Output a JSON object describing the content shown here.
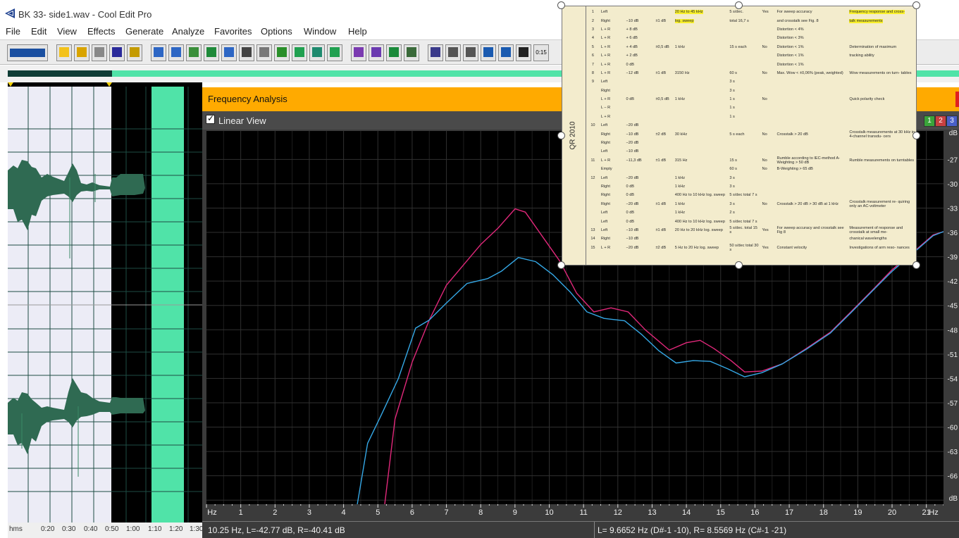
{
  "window": {
    "title": "BK 33- side1.wav - Cool Edit Pro"
  },
  "menu": [
    "File",
    "Edit",
    "View",
    "Effects",
    "Generate",
    "Analyze",
    "Favorites",
    "Options",
    "Window",
    "Help"
  ],
  "toolbar": {
    "buttons": [
      "toggle-wave-icon",
      "new-icon",
      "open-icon",
      "close-icon",
      "save-icon",
      "save-all-icon",
      "undo-icon",
      "redo-icon",
      "repeat-icon",
      "zoom-full-icon",
      "copy-icon",
      "cut-icon",
      "paste-icon",
      "paste-new-icon",
      "mix-paste-icon",
      "crop-icon",
      "trim-icon",
      "spectral-icon",
      "settings-icon",
      "grid-icon",
      "multitrack-icon",
      "view-icon",
      "cd-icon",
      "cursor-icon",
      "play-icon",
      "zoom-icon",
      "time-icon"
    ],
    "time_label": "0:15"
  },
  "waveform": {
    "ruler_unit": "hms",
    "ruler_ticks": [
      "0:20",
      "0:30",
      "0:40",
      "0:50",
      "1:00",
      "1:10",
      "1:20",
      "1:30"
    ]
  },
  "frequency_analysis": {
    "title": "Frequency Analysis",
    "linear_view_label": "Linear View",
    "linear_view_checked": true,
    "channel_buttons": [
      "1",
      "2",
      "3"
    ],
    "status_left": "10.25 Hz, L=-42.77 dB, R=-40.41 dB",
    "status_right": "L= 9.6652 Hz (D#-1 -10), R= 8.5569 Hz (C#-1 -21)",
    "colors": {
      "left": "#e0287a",
      "right": "#35a8e6",
      "grid": "#2e2e2e",
      "background": "#000000",
      "header": "#ffaa00"
    }
  },
  "chart_data": {
    "type": "line",
    "title": "",
    "xlabel": "Hz",
    "ylabel": "dB",
    "xlim": [
      0,
      21.5
    ],
    "ylim": [
      -69.5,
      -23.5
    ],
    "x_ticks": [
      "Hz",
      "1",
      "2",
      "3",
      "4",
      "5",
      "6",
      "7",
      "8",
      "9",
      "10",
      "11",
      "12",
      "13",
      "14",
      "15",
      "16",
      "17",
      "18",
      "19",
      "20",
      "21",
      "Hz"
    ],
    "y_ticks": [
      "dB",
      "-27",
      "-30",
      "-33",
      "-36",
      "-39",
      "-42",
      "-45",
      "-48",
      "-51",
      "-54",
      "-57",
      "-60",
      "-63",
      "-66",
      "dB"
    ],
    "grid": true,
    "series": [
      {
        "color": "#e0287a",
        "points": [
          [
            5.2,
            -69.5
          ],
          [
            5.5,
            -59
          ],
          [
            6.0,
            -52
          ],
          [
            6.5,
            -46.8
          ],
          [
            7.0,
            -42.5
          ],
          [
            7.5,
            -40
          ],
          [
            8.0,
            -37.5
          ],
          [
            8.5,
            -35.5
          ],
          [
            9.0,
            -33.1
          ],
          [
            9.3,
            -33.5
          ],
          [
            9.8,
            -36.5
          ],
          [
            10.3,
            -39.5
          ],
          [
            10.8,
            -43.5
          ],
          [
            11.3,
            -45.8
          ],
          [
            11.8,
            -45.3
          ],
          [
            12.3,
            -45.8
          ],
          [
            12.8,
            -48
          ],
          [
            13.5,
            -50.5
          ],
          [
            14.0,
            -49.6
          ],
          [
            14.4,
            -49.3
          ],
          [
            14.8,
            -50.3
          ],
          [
            15.3,
            -51.8
          ],
          [
            15.7,
            -53.2
          ],
          [
            16.2,
            -53.1
          ],
          [
            16.8,
            -52.2
          ],
          [
            17.5,
            -50.3
          ],
          [
            18.2,
            -48.3
          ],
          [
            18.8,
            -45.8
          ],
          [
            19.5,
            -42.8
          ],
          [
            20.0,
            -40.6
          ],
          [
            20.6,
            -38.5
          ],
          [
            21.2,
            -36.3
          ],
          [
            21.5,
            -35.9
          ]
        ]
      },
      {
        "color": "#35a8e6",
        "points": [
          [
            4.4,
            -69.5
          ],
          [
            4.7,
            -62
          ],
          [
            5.1,
            -58.5
          ],
          [
            5.6,
            -54
          ],
          [
            6.1,
            -47.8
          ],
          [
            6.5,
            -46.8
          ],
          [
            7.0,
            -44.7
          ],
          [
            7.6,
            -42.3
          ],
          [
            8.2,
            -41.7
          ],
          [
            8.6,
            -40.8
          ],
          [
            9.1,
            -39.1
          ],
          [
            9.6,
            -39.6
          ],
          [
            10.1,
            -41.2
          ],
          [
            10.6,
            -43.3
          ],
          [
            11.1,
            -45.8
          ],
          [
            11.6,
            -46.6
          ],
          [
            12.2,
            -46.9
          ],
          [
            12.7,
            -48.6
          ],
          [
            13.2,
            -50.6
          ],
          [
            13.7,
            -52.1
          ],
          [
            14.2,
            -51.8
          ],
          [
            14.7,
            -51.9
          ],
          [
            15.2,
            -52.8
          ],
          [
            15.7,
            -53.8
          ],
          [
            16.2,
            -53.3
          ],
          [
            16.8,
            -52.2
          ],
          [
            17.5,
            -50.4
          ],
          [
            18.2,
            -48.4
          ],
          [
            18.8,
            -45.9
          ],
          [
            19.5,
            -42.9
          ],
          [
            20.0,
            -40.8
          ],
          [
            20.6,
            -38.6
          ],
          [
            21.2,
            -36.4
          ],
          [
            21.5,
            -35.9
          ]
        ]
      }
    ]
  },
  "document_image": {
    "side_label": "QR 2010",
    "rows": [
      [
        "1",
        "Left",
        "",
        "",
        "20 Hz to 45 kHz",
        "5 s/dec.",
        "Yes",
        "For sweep accuracy",
        "Frequency response and cross-"
      ],
      [
        "2",
        "Right",
        "−10 dB",
        "±1 dB",
        "log. sweep",
        "total 16,7 s",
        "",
        "and crosstalk see Fig. 8",
        "talk measurements"
      ],
      [
        "3",
        "L + R",
        "+ 8 dB",
        "",
        "",
        "",
        "",
        "Distortion < 4%",
        ""
      ],
      [
        "4",
        "L + R",
        "+ 6 dB",
        "",
        "",
        "",
        "",
        "Distortion < 3%",
        ""
      ],
      [
        "5",
        "L + R",
        "+ 4 dB",
        "±0,5 dB",
        "1 kHz",
        "15 s each",
        "No",
        "Distortion < 1%",
        "Determination of maximum"
      ],
      [
        "6",
        "L + R",
        "+ 2 dB",
        "",
        "",
        "",
        "",
        "Distortion < 1%",
        "tracking ability"
      ],
      [
        "7",
        "L + R",
        "0 dB",
        "",
        "",
        "",
        "",
        "Distortion < 1%",
        ""
      ],
      [
        "8",
        "L + R",
        "−12 dB",
        "±1 dB",
        "3150 Hz",
        "60 s",
        "No",
        "Max. Wow < ±0,06% (peak, weighted)",
        "Wow measurements on turn- tables"
      ],
      [
        "9",
        "Left",
        "",
        "",
        "",
        "3 s",
        "",
        "",
        ""
      ],
      [
        "",
        "Right",
        "",
        "",
        "",
        "3 s",
        "",
        "",
        ""
      ],
      [
        "",
        "L + R",
        "0 dB",
        "±0,5 dB",
        "1 kHz",
        "1 s",
        "No",
        "",
        "Quick polarity check"
      ],
      [
        "",
        "L − R",
        "",
        "",
        "",
        "1 s",
        "",
        "",
        ""
      ],
      [
        "",
        "L + R",
        "",
        "",
        "",
        "1 s",
        "",
        "",
        ""
      ],
      [
        "10",
        "Left",
        "−20 dB",
        "",
        "",
        "",
        "",
        "",
        ""
      ],
      [
        "",
        "Right",
        "−10 dB",
        "±2 dB",
        "30 kHz",
        "5 s each",
        "No",
        "Crosstalk > 20 dB",
        "Crosstalk measurements at 30 kHz in 4-channel transdu- cers"
      ],
      [
        "",
        "Right",
        "−20 dB",
        "",
        "",
        "",
        "",
        "",
        ""
      ],
      [
        "",
        "Left",
        "−10 dB",
        "",
        "",
        "",
        "",
        "",
        ""
      ],
      [
        "11",
        "L + R",
        "−11,3 dB",
        "±1 dB",
        "315 Hz",
        "15 s",
        "No",
        "Rumble according to IEC-method A-Weighting > 50 dB",
        "Rumble measurements on turntables"
      ],
      [
        "",
        "Empty",
        "",
        "",
        "",
        "60 s",
        "No",
        "B-Weighting > 65 dB",
        ""
      ],
      [
        "12",
        "Left",
        "−20 dB",
        "",
        "1 kHz",
        "3 s",
        "",
        "",
        ""
      ],
      [
        "",
        "Right",
        "0 dB",
        "",
        "1 kHz",
        "3 s",
        "",
        "",
        ""
      ],
      [
        "",
        "Right",
        "0 dB",
        "",
        "400 Hz to 10 kHz log. sweep",
        "5 s/dec total 7 s",
        "",
        "",
        ""
      ],
      [
        "",
        "Right",
        "−20 dB",
        "±1 dB",
        "1 kHz",
        "3 s",
        "No",
        "Crosstalk > 20 dB > 30 dB at 1 kHz",
        "Crosstalk measurement re- quiring only an AC-voltmeter"
      ],
      [
        "",
        "Left",
        "0 dB",
        "",
        "1 kHz",
        "2 s",
        "",
        "",
        ""
      ],
      [
        "",
        "Left",
        "0 dB",
        "",
        "400 Hz to 10 kHz log. sweep",
        "5 s/dec total 7 s",
        "",
        "",
        ""
      ],
      [
        "13",
        "Left",
        "−10 dB",
        "±1 dB",
        "20 Hz to 20 kHz log. sweep",
        "5 s/dec. total 15 s",
        "Yes",
        "For sweep accuracy and crosstalk see Fig 8",
        "Measurement of response and crosstalk at small me-"
      ],
      [
        "14",
        "Right",
        "−10 dB",
        "",
        "",
        "",
        "",
        "",
        "chanical wavelengths"
      ],
      [
        "15",
        "L + R",
        "−20 dB",
        "±2 dB",
        "5 Hz to 20 Hz log. sweep",
        "50 s/dec total 30 s",
        "Yes",
        "Constant velocity",
        "Investigations of arm reso- nances"
      ]
    ]
  }
}
